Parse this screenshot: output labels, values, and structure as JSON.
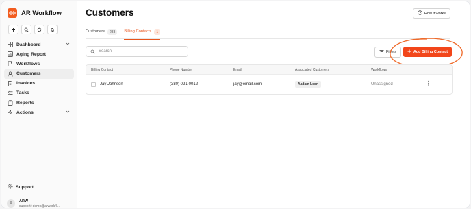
{
  "app": {
    "name": "AR Workflow"
  },
  "sidebar": {
    "items": [
      {
        "label": "Dashboard",
        "icon": "grid-icon",
        "expandable": true
      },
      {
        "label": "Aging Report",
        "icon": "report-icon"
      },
      {
        "label": "Workflows",
        "icon": "flag-icon"
      },
      {
        "label": "Customers",
        "icon": "user-icon",
        "active": true
      },
      {
        "label": "Invoices",
        "icon": "document-icon"
      },
      {
        "label": "Tasks",
        "icon": "checklist-icon"
      },
      {
        "label": "Reports",
        "icon": "clipboard-icon"
      },
      {
        "label": "Actions",
        "icon": "bolt-icon",
        "expandable": true
      }
    ],
    "support_label": "Support"
  },
  "user": {
    "initial": "A",
    "name": "ARW",
    "email": "support+demo@arworkfl..."
  },
  "page": {
    "title": "Customers",
    "how_label": "How it works"
  },
  "tabs": [
    {
      "label": "Customers",
      "count": "283"
    },
    {
      "label": "Billing Contacts",
      "count": "1",
      "active": true
    }
  ],
  "search": {
    "placeholder": "Search"
  },
  "toolbar": {
    "filters_label": "Filters",
    "add_label": "Add Billing Contact"
  },
  "table": {
    "columns": [
      "Billing Contact",
      "Phone Number",
      "Email",
      "Associated Customers",
      "Workflows"
    ],
    "rows": [
      {
        "contact": "Jay Johnson",
        "phone": "(380) 021-0012",
        "email": "jay@email.com",
        "customer": "Aadam Leon",
        "workflows": "Unassigned"
      }
    ]
  },
  "colors": {
    "accent": "#f2461a",
    "highlight_circle": "#ef6a2a"
  }
}
